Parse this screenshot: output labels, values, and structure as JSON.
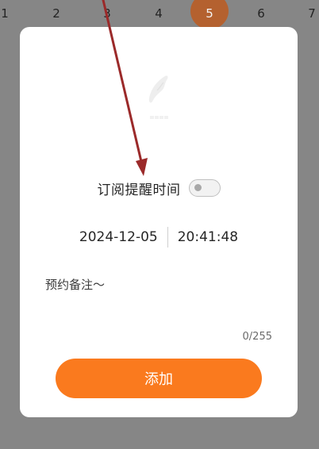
{
  "calendar": {
    "days": [
      "1",
      "2",
      "3",
      "4",
      "5",
      "6",
      "7"
    ],
    "selected_day": "5"
  },
  "dialog": {
    "reminder_label": "订阅提醒时间",
    "reminder_enabled": false,
    "date_value": "2024-12-05",
    "time_value": "20:41:48",
    "note_placeholder": "预约备注～",
    "note_value": "",
    "char_count": "0/255",
    "add_label": "添加"
  },
  "colors": {
    "overlay": "#868686",
    "accent": "#fa7a1e",
    "selected_day_bubble": "#b4612f",
    "annotation_arrow": "#9b2a2a"
  },
  "icons": {
    "empty_illustration": "empty-state-icon",
    "toggle": "toggle-switch",
    "annotation": "arrow-annotation"
  }
}
